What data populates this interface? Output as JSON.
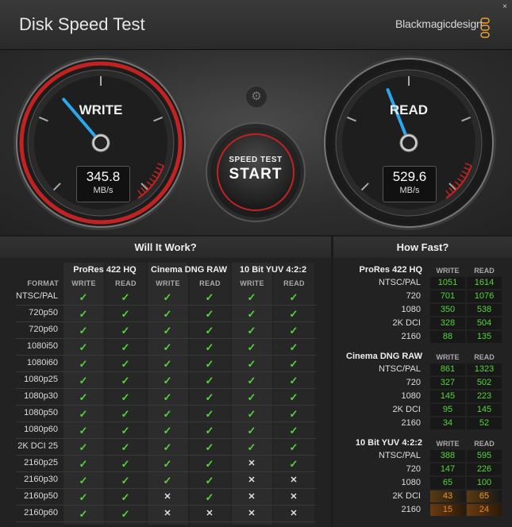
{
  "app": {
    "title": "Disk Speed Test",
    "brand": "Blackmagicdesign",
    "close_glyph": "×"
  },
  "gauges": {
    "write": {
      "label": "WRITE",
      "value": "345.8",
      "unit": "MB/s",
      "needle_fraction": 0.35
    },
    "read": {
      "label": "READ",
      "value": "529.6",
      "unit": "MB/s",
      "needle_fraction": 0.42
    }
  },
  "start_button": {
    "line1": "SPEED TEST",
    "line2": "START"
  },
  "settings_icon": "gear-icon",
  "will_it_work": {
    "title": "Will It Work?",
    "format_header": "FORMAT",
    "groups": [
      "ProRes 422 HQ",
      "Cinema DNG RAW",
      "10 Bit YUV 4:2:2"
    ],
    "subheaders": [
      "WRITE",
      "READ",
      "WRITE",
      "READ",
      "WRITE",
      "READ"
    ],
    "rows": [
      {
        "label": "NTSC/PAL",
        "cells": [
          1,
          1,
          1,
          1,
          1,
          1
        ]
      },
      {
        "label": "720p50",
        "cells": [
          1,
          1,
          1,
          1,
          1,
          1
        ]
      },
      {
        "label": "720p60",
        "cells": [
          1,
          1,
          1,
          1,
          1,
          1
        ]
      },
      {
        "label": "1080i50",
        "cells": [
          1,
          1,
          1,
          1,
          1,
          1
        ]
      },
      {
        "label": "1080i60",
        "cells": [
          1,
          1,
          1,
          1,
          1,
          1
        ]
      },
      {
        "label": "1080p25",
        "cells": [
          1,
          1,
          1,
          1,
          1,
          1
        ]
      },
      {
        "label": "1080p30",
        "cells": [
          1,
          1,
          1,
          1,
          1,
          1
        ]
      },
      {
        "label": "1080p50",
        "cells": [
          1,
          1,
          1,
          1,
          1,
          1
        ]
      },
      {
        "label": "1080p60",
        "cells": [
          1,
          1,
          1,
          1,
          1,
          1
        ]
      },
      {
        "label": "2K DCI 25",
        "cells": [
          1,
          1,
          1,
          1,
          1,
          1
        ]
      },
      {
        "label": "2160p25",
        "cells": [
          1,
          1,
          1,
          1,
          0,
          1
        ]
      },
      {
        "label": "2160p30",
        "cells": [
          1,
          1,
          1,
          1,
          0,
          0
        ]
      },
      {
        "label": "2160p50",
        "cells": [
          1,
          1,
          0,
          1,
          0,
          0
        ]
      },
      {
        "label": "2160p60",
        "cells": [
          1,
          1,
          0,
          0,
          0,
          0
        ]
      }
    ],
    "yes_glyph": "✓",
    "no_glyph": "✕"
  },
  "how_fast": {
    "title": "How Fast?",
    "groups": [
      {
        "name": "ProRes 422 HQ",
        "write_label": "WRITE",
        "read_label": "READ",
        "rows": [
          {
            "label": "NTSC/PAL",
            "write": "1051",
            "read": "1614",
            "write_status": "ok",
            "read_status": "ok"
          },
          {
            "label": "720",
            "write": "701",
            "read": "1076",
            "write_status": "ok",
            "read_status": "ok"
          },
          {
            "label": "1080",
            "write": "350",
            "read": "538",
            "write_status": "ok",
            "read_status": "ok"
          },
          {
            "label": "2K DCI",
            "write": "328",
            "read": "504",
            "write_status": "ok",
            "read_status": "ok"
          },
          {
            "label": "2160",
            "write": "88",
            "read": "135",
            "write_status": "ok",
            "read_status": "ok"
          }
        ]
      },
      {
        "name": "Cinema DNG RAW",
        "write_label": "WRITE",
        "read_label": "READ",
        "rows": [
          {
            "label": "NTSC/PAL",
            "write": "861",
            "read": "1323",
            "write_status": "ok",
            "read_status": "ok"
          },
          {
            "label": "720",
            "write": "327",
            "read": "502",
            "write_status": "ok",
            "read_status": "ok"
          },
          {
            "label": "1080",
            "write": "145",
            "read": "223",
            "write_status": "ok",
            "read_status": "ok"
          },
          {
            "label": "2K DCI",
            "write": "95",
            "read": "145",
            "write_status": "ok",
            "read_status": "ok"
          },
          {
            "label": "2160",
            "write": "34",
            "read": "52",
            "write_status": "ok",
            "read_status": "ok"
          }
        ]
      },
      {
        "name": "10 Bit YUV 4:2:2",
        "write_label": "WRITE",
        "read_label": "READ",
        "rows": [
          {
            "label": "NTSC/PAL",
            "write": "388",
            "read": "595",
            "write_status": "ok",
            "read_status": "ok"
          },
          {
            "label": "720",
            "write": "147",
            "read": "226",
            "write_status": "ok",
            "read_status": "ok"
          },
          {
            "label": "1080",
            "write": "65",
            "read": "100",
            "write_status": "ok",
            "read_status": "ok"
          },
          {
            "label": "2K DCI",
            "write": "43",
            "read": "65",
            "write_status": "warn",
            "read_status": "warn"
          },
          {
            "label": "2160",
            "write": "15",
            "read": "24",
            "write_status": "bad",
            "read_status": "bad"
          }
        ]
      }
    ]
  },
  "colors": {
    "accent_red": "#c32222",
    "needle_blue": "#29a8f0",
    "ok_green": "#54d63a",
    "warn_orange": "#e8872a"
  }
}
